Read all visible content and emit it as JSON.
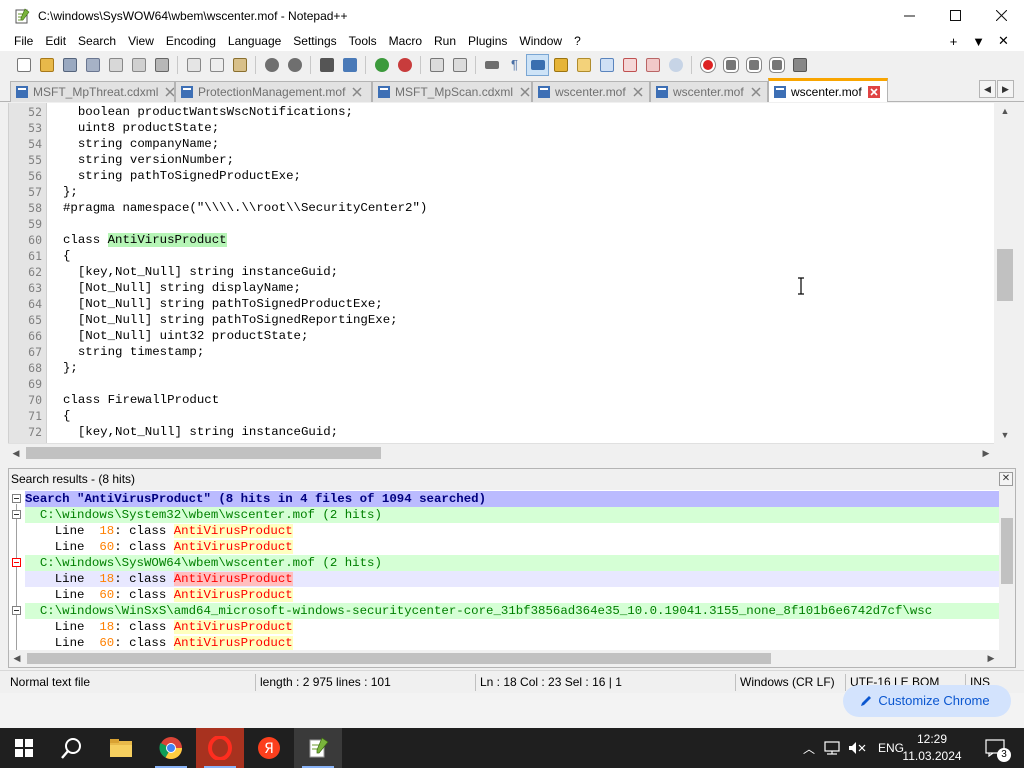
{
  "window": {
    "title": "C:\\windows\\SysWOW64\\wbem\\wscenter.mof - Notepad++"
  },
  "menu": {
    "items": [
      "File",
      "Edit",
      "Search",
      "View",
      "Encoding",
      "Language",
      "Settings",
      "Tools",
      "Macro",
      "Run",
      "Plugins",
      "Window",
      "?"
    ],
    "right": [
      "+",
      "▼",
      "✕"
    ]
  },
  "toolbar": {
    "buttons": [
      "new-file-icon",
      "open-file-icon",
      "save-icon",
      "save-all-icon",
      "close-icon",
      "close-all-icon",
      "print-icon",
      "cut-icon",
      "copy-icon",
      "paste-icon",
      "undo-icon",
      "redo-icon",
      "find-icon",
      "replace-icon",
      "zoom-in-icon",
      "zoom-out-icon",
      "sync-vertical-icon",
      "sync-horizontal-icon",
      "word-wrap-icon",
      "show-all-chars-icon",
      "indent-guide-icon",
      "user-language-icon",
      "document-map-icon",
      "function-list-icon",
      "folder-workspace-icon",
      "monitoring-icon",
      "record-macro-icon",
      "stop-recording-icon",
      "playback-macro-icon",
      "run-macro-multiple-icon",
      "save-macro-icon"
    ]
  },
  "tabs": [
    {
      "label": "MSFT_MpThreat.cdxml",
      "active": false
    },
    {
      "label": "ProtectionManagement.mof",
      "active": false
    },
    {
      "label": "MSFT_MpScan.cdxml",
      "active": false
    },
    {
      "label": "wscenter.mof",
      "active": false
    },
    {
      "label": "wscenter.mof",
      "active": false
    },
    {
      "label": "wscenter.mof",
      "active": true
    }
  ],
  "editor": {
    "lines": [
      {
        "n": "52",
        "text": "  boolean productWantsWscNotifications;"
      },
      {
        "n": "53",
        "text": "  uint8 productState;"
      },
      {
        "n": "54",
        "text": "  string companyName;"
      },
      {
        "n": "55",
        "text": "  string versionNumber;"
      },
      {
        "n": "56",
        "text": "  string pathToSignedProductExe;"
      },
      {
        "n": "57",
        "text": "};"
      },
      {
        "n": "58",
        "text": "#pragma namespace(\"\\\\\\\\.\\\\root\\\\SecurityCenter2\")"
      },
      {
        "n": "59",
        "text": ""
      },
      {
        "n": "60",
        "pre": "class ",
        "hl": "AntiVirusProduct",
        "post": ""
      },
      {
        "n": "61",
        "text": "{"
      },
      {
        "n": "62",
        "text": "  [key,Not_Null] string instanceGuid;"
      },
      {
        "n": "63",
        "text": "  [Not_Null] string displayName;"
      },
      {
        "n": "64",
        "text": "  [Not_Null] string pathToSignedProductExe;"
      },
      {
        "n": "65",
        "text": "  [Not_Null] string pathToSignedReportingExe;"
      },
      {
        "n": "66",
        "text": "  [Not_Null] uint32 productState;"
      },
      {
        "n": "67",
        "text": "  string timestamp;"
      },
      {
        "n": "68",
        "text": "};"
      },
      {
        "n": "69",
        "text": ""
      },
      {
        "n": "70",
        "text": "class FirewallProduct"
      },
      {
        "n": "71",
        "text": "{"
      },
      {
        "n": "72",
        "text": "  [key,Not_Null] string instanceGuid;"
      }
    ]
  },
  "search": {
    "title": "Search results - (8 hits)",
    "close_label": "✕",
    "header": "Search \"AntiVirusProduct\" (8 hits in 4 files of 1094 searched)",
    "results": [
      {
        "kind": "file",
        "text": "  C:\\windows\\System32\\wbem\\wscenter.mof (2 hits)"
      },
      {
        "kind": "hit",
        "pre": "    Line  ",
        "num": "18",
        "mid": ": class ",
        "kw": "AntiVirusProduct",
        "selected": false
      },
      {
        "kind": "hit",
        "pre": "    Line  ",
        "num": "60",
        "mid": ": class ",
        "kw": "AntiVirusProduct",
        "selected": false
      },
      {
        "kind": "file",
        "text": "  C:\\windows\\SysWOW64\\wbem\\wscenter.mof (2 hits)"
      },
      {
        "kind": "hit",
        "pre": "    Line  ",
        "num": "18",
        "mid": ": class ",
        "kw": "AntiVirusProduct",
        "selected": true
      },
      {
        "kind": "hit",
        "pre": "    Line  ",
        "num": "60",
        "mid": ": class ",
        "kw": "AntiVirusProduct",
        "selected": false
      },
      {
        "kind": "file",
        "text": "  C:\\windows\\WinSxS\\amd64_microsoft-windows-securitycenter-core_31bf3856ad364e35_10.0.19041.3155_none_8f101b6e6742d7cf\\wsc"
      },
      {
        "kind": "hit",
        "pre": "    Line  ",
        "num": "18",
        "mid": ": class ",
        "kw": "AntiVirusProduct",
        "selected": false
      },
      {
        "kind": "hit",
        "pre": "    Line  ",
        "num": "60",
        "mid": ": class ",
        "kw": "AntiVirusProduct",
        "selected": false
      }
    ]
  },
  "status": {
    "type": "Normal text file",
    "length": "length : 2 975    lines : 101",
    "position": "Ln : 18    Col : 23    Sel : 16 | 1",
    "eol": "Windows (CR LF)",
    "encoding": "UTF-16 LE BOM",
    "mode": "INS"
  },
  "behind": {
    "customize": "Customize Chrome"
  },
  "taskbar": {
    "apps": [
      "start-icon",
      "search-icon",
      "file-explorer-icon",
      "chrome-icon",
      "opera-icon",
      "yandex-browser-icon",
      "notepadpp-icon"
    ],
    "language": "ENG",
    "time": "12:29",
    "date": "11.03.2024",
    "notifications": "3"
  }
}
